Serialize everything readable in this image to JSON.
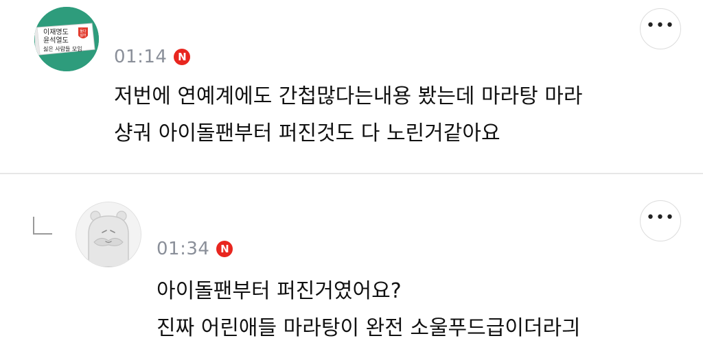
{
  "comments": [
    {
      "name": "",
      "time": "01:14",
      "badge": "N",
      "lines": [
        "저번에 연예계에도 간첩많다는내용 봤는데 마라탕 마라",
        "샹궈 아이돌팬부터 퍼진것도 다 노린거같아요"
      ],
      "avatar": {
        "lines": [
          "이재명도",
          "윤석열도",
          "싫은 사람들 모임"
        ],
        "shield": [
          "둘다",
          "싫어"
        ]
      },
      "more": "•••"
    },
    {
      "name": "",
      "time": "01:34",
      "badge": "N",
      "lines": [
        "아이돌팬부터 퍼진거였어요?",
        "진짜 어린애들 마라탕이 완전 소울푸드급이더라긔"
      ],
      "more": "•••"
    }
  ],
  "colors": {
    "badge": "#e8261f",
    "avatar_green": "#2e9c7c",
    "time": "#8a8f99"
  }
}
